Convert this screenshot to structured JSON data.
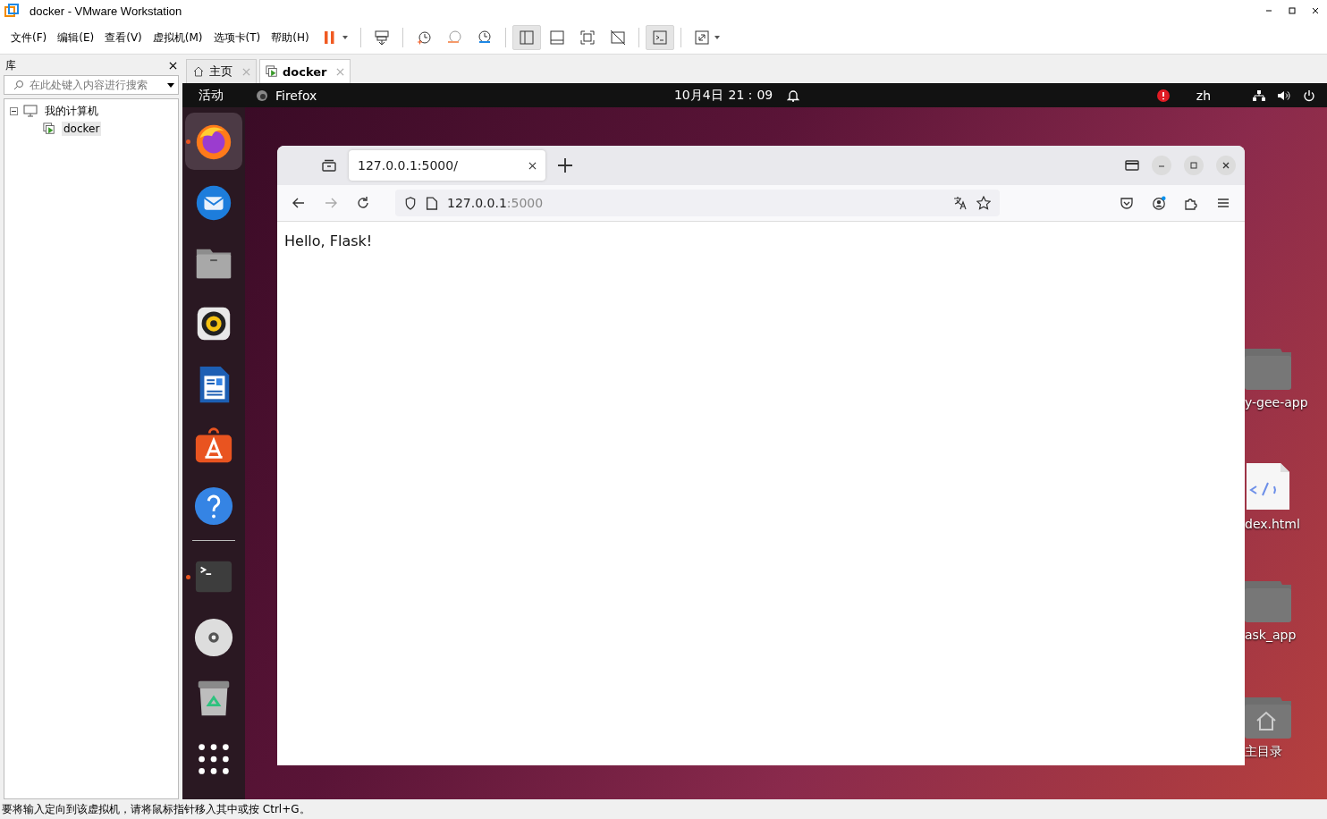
{
  "window": {
    "title": "docker - VMware Workstation"
  },
  "menu": [
    "文件(F)",
    "编辑(E)",
    "查看(V)",
    "虚拟机(M)",
    "选项卡(T)",
    "帮助(H)"
  ],
  "toolbar": [
    {
      "kind": "pause",
      "selected": false,
      "menu": true
    },
    {
      "kind": "send-keys",
      "selected": false,
      "menu": false
    },
    {
      "kind": "snapshot",
      "selected": false,
      "menu": false
    },
    {
      "kind": "revert",
      "selected": false,
      "menu": false
    },
    {
      "kind": "manage",
      "selected": false,
      "menu": false
    },
    {
      "kind": "library",
      "selected": true,
      "menu": false
    },
    {
      "kind": "thumbs",
      "selected": false,
      "menu": false
    },
    {
      "kind": "fullscreen",
      "selected": false,
      "menu": false
    },
    {
      "kind": "unity",
      "selected": false,
      "menu": false
    },
    {
      "kind": "console",
      "selected": true,
      "menu": false
    },
    {
      "kind": "stretch",
      "selected": false,
      "menu": true
    }
  ],
  "library": {
    "title": "库",
    "search": {
      "placeholder": "在此处键入内容进行搜索"
    },
    "tree": [
      {
        "label": "我的计算机",
        "expanded": true,
        "selected": false,
        "children": [
          {
            "label": "docker",
            "selected": true
          }
        ]
      }
    ]
  },
  "tabs": [
    {
      "label": "主页",
      "kind": "home",
      "selected": false
    },
    {
      "label": "docker",
      "kind": "vm",
      "selected": true
    }
  ],
  "guest": {
    "topbar": {
      "activities": "活动",
      "app": "Firefox",
      "date": "10月4日",
      "time": "21：09",
      "lang": "zh"
    },
    "dock": [
      {
        "kind": "firefox",
        "running": true,
        "selected": true
      },
      {
        "kind": "thunderbird",
        "running": false,
        "selected": false
      },
      {
        "kind": "files",
        "running": false,
        "selected": false
      },
      {
        "kind": "rhythmbox",
        "running": false,
        "selected": false
      },
      {
        "kind": "writer",
        "running": false,
        "selected": false
      },
      {
        "kind": "store",
        "running": false,
        "selected": false
      },
      {
        "kind": "help",
        "running": false,
        "selected": false
      },
      {
        "kind": "separator"
      },
      {
        "kind": "terminal",
        "running": true,
        "selected": false
      },
      {
        "kind": "disc",
        "running": false,
        "selected": false
      },
      {
        "kind": "trash",
        "running": false,
        "selected": false
      },
      {
        "kind": "apps",
        "running": false,
        "selected": false
      }
    ],
    "desktop": [
      {
        "kind": "folder",
        "label": "y-gee-app"
      },
      {
        "kind": "html",
        "label": "dex.html"
      },
      {
        "kind": "folder",
        "label": "ask_app"
      },
      {
        "kind": "home",
        "label": "主目录"
      }
    ],
    "browser": {
      "tab": "127.0.0.1:5000/",
      "url": "127.0.0.1",
      "url_port": ":5000",
      "forward_disabled": true,
      "content": "Hello, Flask!"
    }
  },
  "status_bar": "要将输入定向到该虚拟机，请将鼠标指针移入其中或按 Ctrl+G。"
}
